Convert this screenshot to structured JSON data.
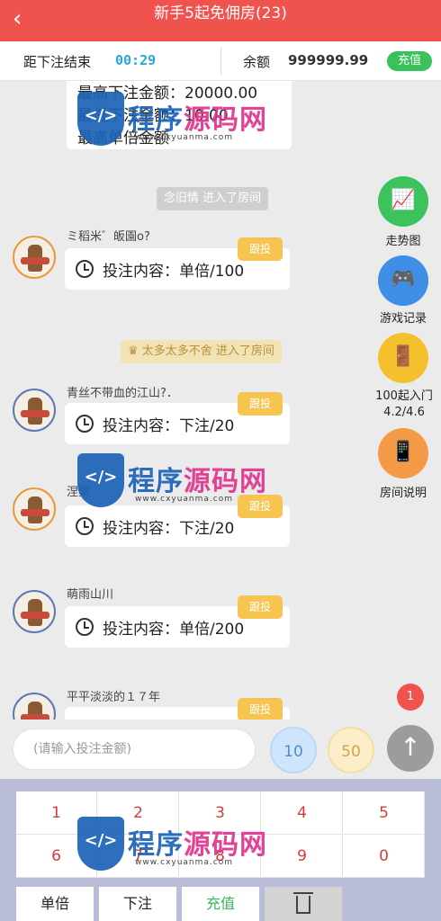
{
  "header": {
    "back_icon": "‹",
    "title": "新手5起免佣房(23)"
  },
  "status": {
    "countdown_label": "距下注结束",
    "countdown_value": "00:29",
    "balance_label": "余额",
    "balance_value": "999999.99",
    "recharge_label": "充值"
  },
  "rules_card": {
    "line1": "最高下注金额：20000.00",
    "line2": "最低下注金额：10.00",
    "line3": "最高单倍金额"
  },
  "system_messages": [
    {
      "text": "念旧情 进入了房间"
    },
    {
      "text": "太多太多不舍 进入了房间"
    }
  ],
  "messages": [
    {
      "user": "ミ稻米゛皈園ο?",
      "content": "投注内容：单倍/100",
      "tag": "跟投"
    },
    {
      "user": "青丝不带血的江山?．",
      "content": "投注内容：下注/20",
      "tag": "跟投"
    },
    {
      "user": "涅槃",
      "content": "投注内容：下注/20",
      "tag": "跟投"
    },
    {
      "user": "萌雨山川",
      "content": "投注内容：单倍/200",
      "tag": "跟投"
    },
    {
      "user": "平平淡淡的１７年",
      "content": "",
      "tag": "跟投"
    }
  ],
  "side_menu": [
    {
      "label": "走势图",
      "icon": "trend-chart-icon",
      "color": "#3cc35c"
    },
    {
      "label": "游戏记录",
      "icon": "gamepad-icon",
      "color": "#3f8ee6"
    },
    {
      "label": "100起入门4.2/4.6",
      "icon": "door-icon",
      "color": "#f5c02e"
    },
    {
      "label": "房间说明",
      "icon": "phone-info-icon",
      "color": "#f49a47"
    }
  ],
  "unread_badge": "1",
  "bet_input": {
    "placeholder": "(请输入投注金额)"
  },
  "chips": {
    "chip_10": "10",
    "chip_50": "50"
  },
  "keypad": {
    "keys": [
      "1",
      "2",
      "3",
      "4",
      "5",
      "6",
      "7",
      "8",
      "9",
      "0"
    ],
    "actions": {
      "single": "单倍",
      "bet": "下注",
      "recharge": "充值"
    }
  },
  "watermark": {
    "text_blue": "程序",
    "text_pink": "源码网",
    "url": "www.cxyuanma.com"
  }
}
